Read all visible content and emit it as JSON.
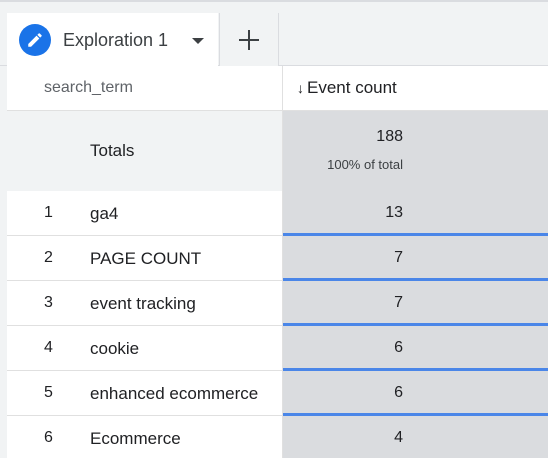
{
  "tabs": {
    "active_label": "Exploration 1",
    "active_icon": "pencil-icon",
    "add_icon": "plus-icon",
    "accent": "#1a73e8"
  },
  "table": {
    "dimension_header": "search_term",
    "metric_header": "Event count",
    "sort_indicator": "↓",
    "totals": {
      "label": "Totals",
      "value": "188",
      "pct": "100% of total"
    },
    "rows": [
      {
        "index": "1",
        "term": "ga4",
        "value": "13",
        "share": 1.0
      },
      {
        "index": "2",
        "term": "PAGE COUNT",
        "value": "7",
        "share": 1.0
      },
      {
        "index": "3",
        "term": "event tracking",
        "value": "7",
        "share": 1.0
      },
      {
        "index": "4",
        "term": "cookie",
        "value": "6",
        "share": 1.0
      },
      {
        "index": "5",
        "term": "enhanced ecommerce",
        "value": "6",
        "share": 1.0
      },
      {
        "index": "6",
        "term": "Ecommerce",
        "value": "4",
        "share": 1.0
      }
    ],
    "bar_color": "#4a86e8"
  }
}
